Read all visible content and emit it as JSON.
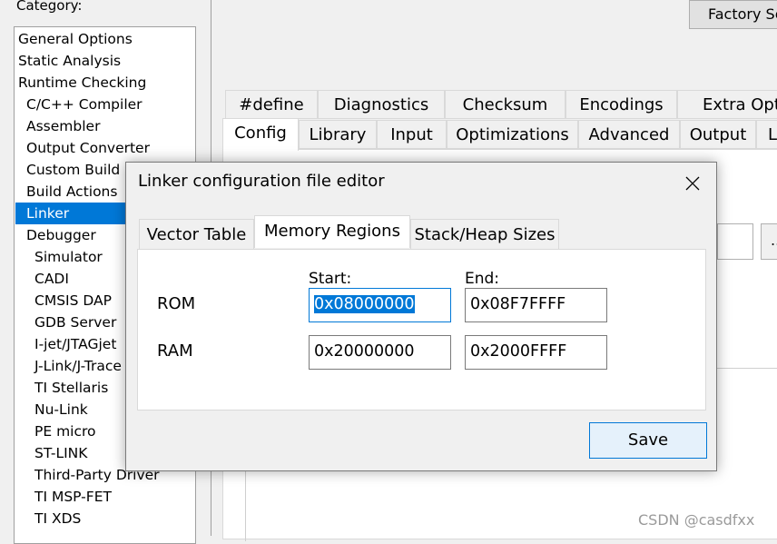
{
  "category": {
    "label": "Category:",
    "items": [
      {
        "label": "General Options"
      },
      {
        "label": "Static Analysis"
      },
      {
        "label": "Runtime Checking"
      },
      {
        "label": "C/C++ Compiler"
      },
      {
        "label": "Assembler"
      },
      {
        "label": "Output Converter"
      },
      {
        "label": "Custom Build"
      },
      {
        "label": "Build Actions"
      },
      {
        "label": "Linker",
        "selected": true
      },
      {
        "label": "Debugger"
      },
      {
        "label": "Simulator"
      },
      {
        "label": "CADI"
      },
      {
        "label": "CMSIS DAP"
      },
      {
        "label": "GDB Server"
      },
      {
        "label": "I-jet/JTAGjet"
      },
      {
        "label": "J-Link/J-Trace"
      },
      {
        "label": "TI Stellaris"
      },
      {
        "label": "Nu-Link"
      },
      {
        "label": "PE micro"
      },
      {
        "label": "ST-LINK"
      },
      {
        "label": "Third-Party Driver"
      },
      {
        "label": "TI MSP-FET"
      },
      {
        "label": "TI XDS"
      }
    ]
  },
  "factory_button": "Factory Se",
  "tabs_row1": [
    "#define",
    "Diagnostics",
    "Checksum",
    "Encodings",
    "Extra Optio"
  ],
  "tabs_row2": [
    "Config",
    "Library",
    "Input",
    "Optimizations",
    "Advanced",
    "Output",
    "Li"
  ],
  "active_tab": "Config",
  "bg_browse": "...",
  "dialog": {
    "title": "Linker configuration file editor",
    "tabs": [
      "Vector Table",
      "Memory Regions",
      "Stack/Heap Sizes"
    ],
    "active_tab": "Memory Regions",
    "start_label": "Start:",
    "end_label": "End:",
    "rows": [
      {
        "name": "ROM",
        "start": "0x08000000",
        "end": "0x08F7FFFF"
      },
      {
        "name": "RAM",
        "start": "0x20000000",
        "end": "0x2000FFFF"
      }
    ],
    "save_label": "Save"
  },
  "watermark": "CSDN @casdfxx",
  "colors": {
    "selection": "#0078d7",
    "window_bg": "#f0f0f0",
    "button_hover": "#e5f1fb"
  }
}
